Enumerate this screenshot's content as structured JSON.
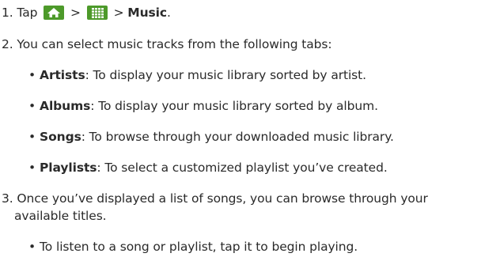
{
  "steps": [
    {
      "num": "1.",
      "prefix": "Tap ",
      "sep1": " > ",
      "sep2": " > ",
      "target": "Music",
      "end": ".",
      "icons": [
        {
          "name": "home-icon",
          "bg": "#4d9a2a"
        },
        {
          "name": "apps-grid-icon",
          "bg": "#4d9a2a"
        }
      ]
    },
    {
      "num": "2.",
      "text": "You can select music tracks from the following tabs:",
      "bullets": [
        {
          "term": "Artists",
          "desc": ": To display your music library sorted by artist."
        },
        {
          "term": "Albums",
          "desc": ": To display your music library sorted by album."
        },
        {
          "term": "Songs",
          "desc": ": To browse through your downloaded music library."
        },
        {
          "term": "Playlists",
          "desc": ": To select a customized playlist you’ve created."
        }
      ]
    },
    {
      "num": "3.",
      "text_line1": "Once you’ve displayed a list of songs, you can browse through your",
      "text_line2": "available titles.",
      "bullets": [
        {
          "text": "To listen to a song or playlist, tap it to begin playing."
        }
      ]
    }
  ],
  "bullet_char": "•"
}
